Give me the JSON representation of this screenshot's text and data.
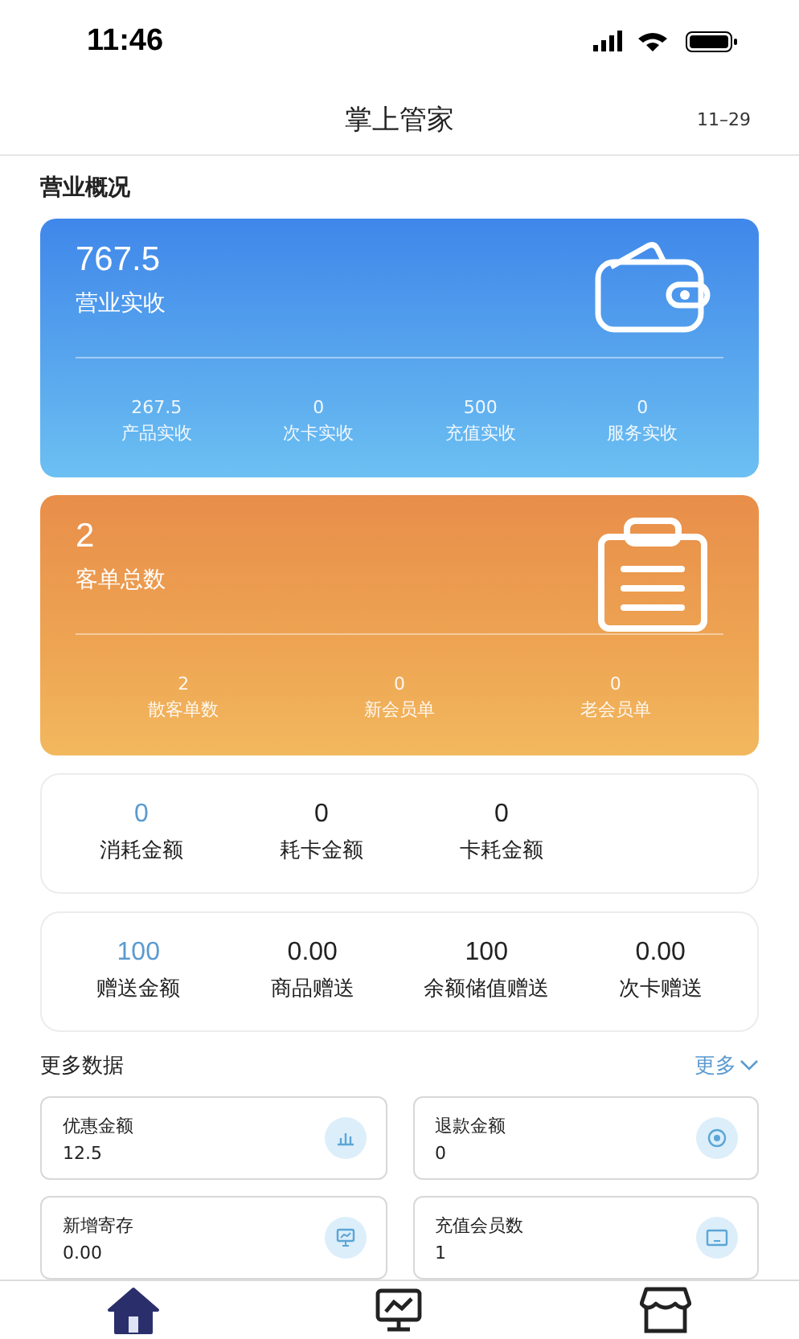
{
  "status_bar": {
    "time": "11:46"
  },
  "nav": {
    "title": "掌上管家",
    "date": "11–29"
  },
  "overview": {
    "title": "营业概况",
    "cards": [
      {
        "kind": "wallet",
        "value": "767.5",
        "label": "营业实收",
        "items": [
          {
            "value": "267.5",
            "label": "产品实收"
          },
          {
            "value": "0",
            "label": "次卡实收"
          },
          {
            "value": "500",
            "label": "充值实收"
          },
          {
            "value": "0",
            "label": "服务实收"
          }
        ]
      },
      {
        "kind": "clipboard",
        "value": "2",
        "label": "客单总数",
        "items": [
          {
            "value": "2",
            "label": "散客单数"
          },
          {
            "value": "0",
            "label": "新会员单"
          },
          {
            "value": "0",
            "label": "老会员单"
          }
        ]
      }
    ]
  },
  "stat_panels": [
    {
      "items": [
        {
          "value": "0",
          "label": "消耗金额",
          "color": "#5b9bd0"
        },
        {
          "value": "0",
          "label": "耗卡金额",
          "color": "#222222"
        },
        {
          "value": "0",
          "label": "卡耗金额",
          "color": "#222222"
        }
      ]
    },
    {
      "items": [
        {
          "value": "100",
          "label": "赠送金额",
          "color": "#5b9bd0"
        },
        {
          "value": "0.00",
          "label": "商品赠送",
          "color": "#222222"
        },
        {
          "value": "100",
          "label": "余额储值赠送",
          "color": "#222222"
        },
        {
          "value": "0.00",
          "label": "次卡赠送",
          "color": "#222222"
        }
      ]
    }
  ],
  "more_data": {
    "title": "更多数据",
    "more_link": "更多",
    "tiles": [
      {
        "kind": "chart",
        "label": "优惠金额",
        "value": "12.5"
      },
      {
        "kind": "target",
        "label": "退款金额",
        "value": "0"
      },
      {
        "kind": "monitor",
        "label": "新增寄存",
        "value": "0.00"
      },
      {
        "kind": "card",
        "label": "充值会员数",
        "value": "1"
      }
    ]
  },
  "tab_bar": [
    {
      "kind": "home",
      "selected": true
    },
    {
      "kind": "report",
      "selected": false
    },
    {
      "kind": "store",
      "selected": false
    }
  ]
}
